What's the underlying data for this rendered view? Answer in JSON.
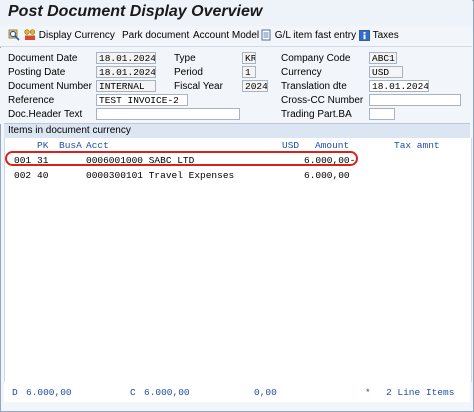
{
  "window": {
    "title": "Post Document Display Overview"
  },
  "toolbar": {
    "display_currency": "Display Currency",
    "park_document": "Park document",
    "account_model": "Account Model",
    "gl_fast_entry": "G/L item fast entry",
    "taxes": "Taxes"
  },
  "header": {
    "document_date_label": "Document Date",
    "document_date": "18.01.2024",
    "type_label": "Type",
    "type": "KR",
    "company_code_label": "Company Code",
    "company_code": "ABC1",
    "posting_date_label": "Posting Date",
    "posting_date": "18.01.2024",
    "period_label": "Period",
    "period": "1",
    "currency_label": "Currency",
    "currency": "USD",
    "document_number_label": "Document Number",
    "document_number": "INTERNAL",
    "fiscal_year_label": "Fiscal Year",
    "fiscal_year": "2024",
    "translation_date_label": "Translation dte",
    "translation_date": "18.01.2024",
    "reference_label": "Reference",
    "reference": "TEST INVOICE-2",
    "cross_cc_label": "Cross-CC Number",
    "cross_cc": "",
    "doc_header_text_label": "Doc.Header Text",
    "doc_header_text": "",
    "trading_partner_label": "Trading Part.BA",
    "trading_partner": ""
  },
  "items": {
    "section_title": "Items in document currency",
    "columns": {
      "pk": "PK",
      "busa": "BusA",
      "acct": "Acct",
      "usd": "USD",
      "amount": "Amount",
      "tax_amnt": "Tax amnt"
    },
    "rows": [
      {
        "line": "001",
        "pk": "31",
        "acct": "0006001000 SABC LTD",
        "amount": "6.000,00-"
      },
      {
        "line": "002",
        "pk": "40",
        "acct": "0000300101 Travel Expenses",
        "amount": "6.000,00"
      }
    ]
  },
  "footer": {
    "debit_label": "D",
    "debit": "6.000,00",
    "credit_label": "C",
    "credit": "6.000,00",
    "balance": "0,00",
    "star": "*",
    "line_items": "2  Line Items"
  },
  "colors": {
    "highlight": "#d9221c",
    "header_text": "#1f4ea8",
    "section_bg": "#dce6f2"
  }
}
